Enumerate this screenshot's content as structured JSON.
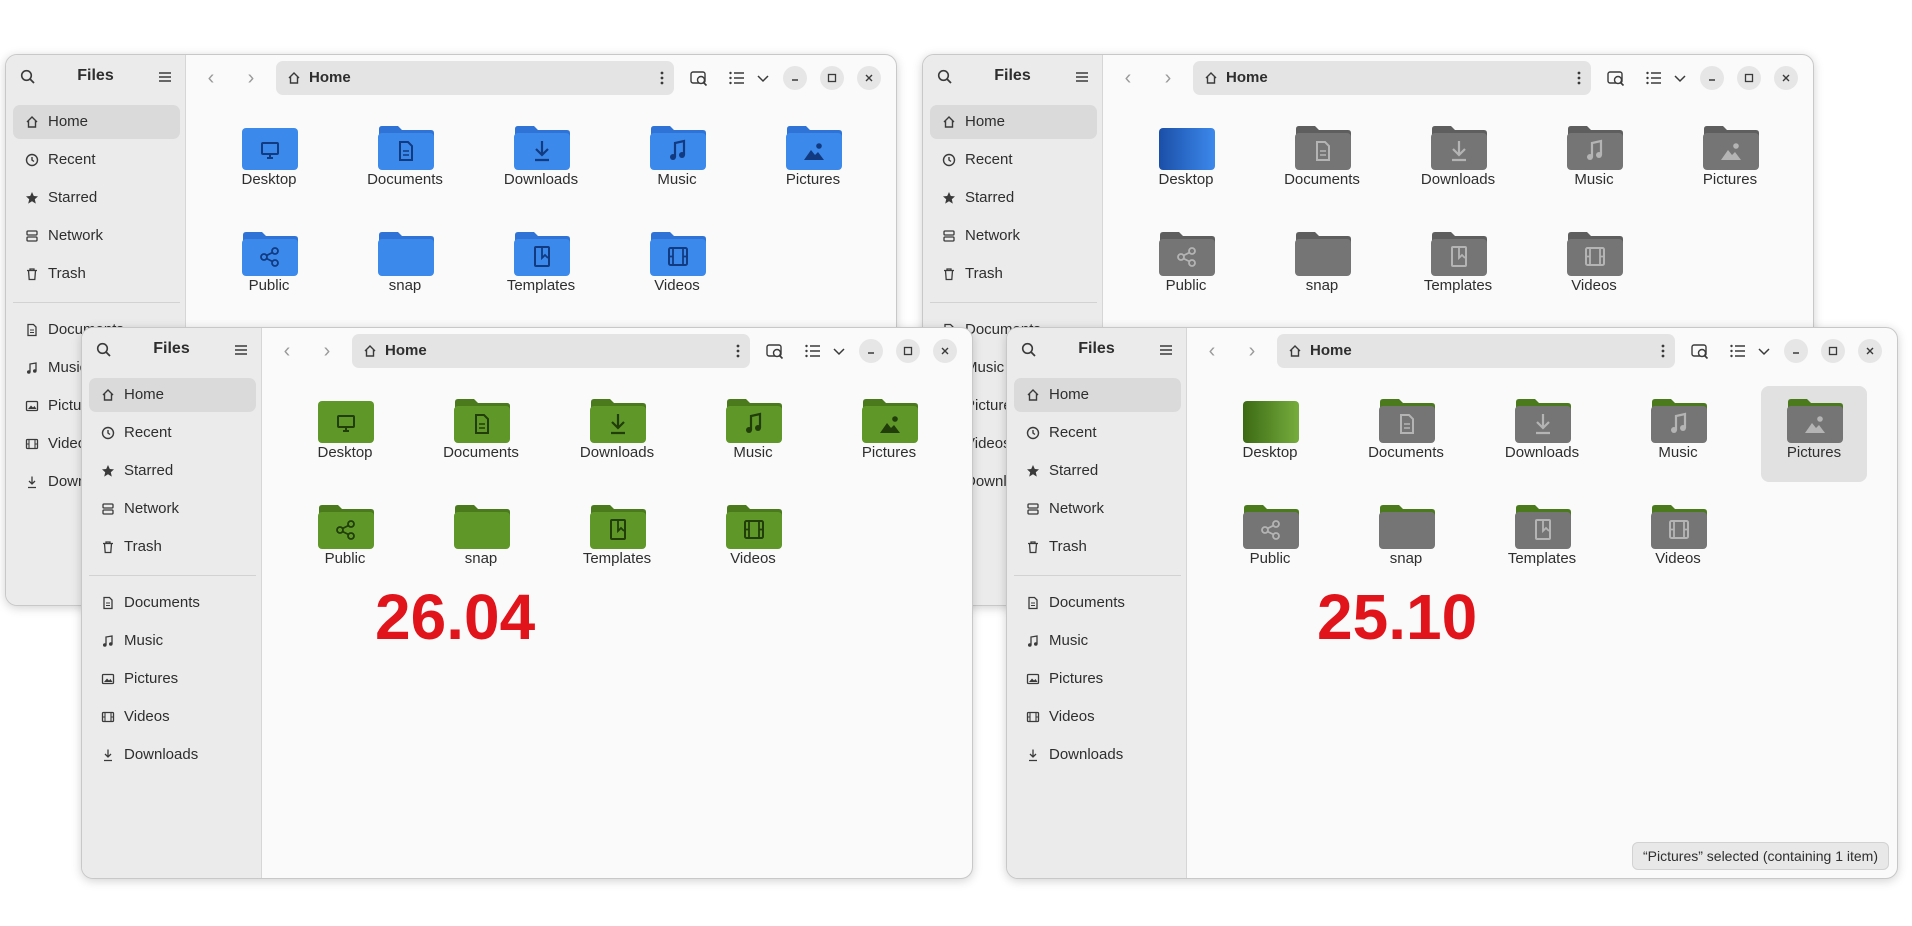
{
  "app_title": "Files",
  "path_label": "Home",
  "sidebar": {
    "places": [
      {
        "label": "Home",
        "icon": "home-icon"
      },
      {
        "label": "Recent",
        "icon": "clock-icon"
      },
      {
        "label": "Starred",
        "icon": "star-icon"
      },
      {
        "label": "Network",
        "icon": "network-icon"
      },
      {
        "label": "Trash",
        "icon": "trash-icon"
      }
    ],
    "bookmarks": [
      {
        "label": "Documents",
        "icon": "document-icon"
      },
      {
        "label": "Music",
        "icon": "music-icon"
      },
      {
        "label": "Pictures",
        "icon": "image-icon"
      },
      {
        "label": "Videos",
        "icon": "film-icon"
      },
      {
        "label": "Downloads",
        "icon": "download-icon"
      }
    ]
  },
  "folders": [
    {
      "name": "Desktop",
      "glyph": "desktop"
    },
    {
      "name": "Documents",
      "glyph": "document"
    },
    {
      "name": "Downloads",
      "glyph": "download"
    },
    {
      "name": "Music",
      "glyph": "music"
    },
    {
      "name": "Pictures",
      "glyph": "picture"
    },
    {
      "name": "Public",
      "glyph": "share"
    },
    {
      "name": "snap",
      "glyph": "none"
    },
    {
      "name": "Templates",
      "glyph": "template"
    },
    {
      "name": "Videos",
      "glyph": "film"
    }
  ],
  "windows": [
    {
      "id": "w1",
      "theme": "blue",
      "selected": ""
    },
    {
      "id": "w2",
      "theme": "grey",
      "selected": ""
    },
    {
      "id": "w3",
      "theme": "green",
      "selected": "",
      "version_label": "26.04"
    },
    {
      "id": "w4",
      "theme": "green-grey",
      "selected": "Pictures",
      "version_label": "25.10",
      "status_text": "“Pictures” selected  (containing 1 item)"
    }
  ],
  "colors": {
    "blue_back": "#2f73d6",
    "blue_front": "#3c89ec",
    "blue_glyph": "#113a80",
    "grey_back": "#5e5e5e",
    "grey_front": "#757575",
    "grey_glyph": "#b4b4b4",
    "green_back": "#4a7a1c",
    "green_front": "#5f9728",
    "green_glyph": "#203d0a",
    "version_red": "#e0141a"
  }
}
